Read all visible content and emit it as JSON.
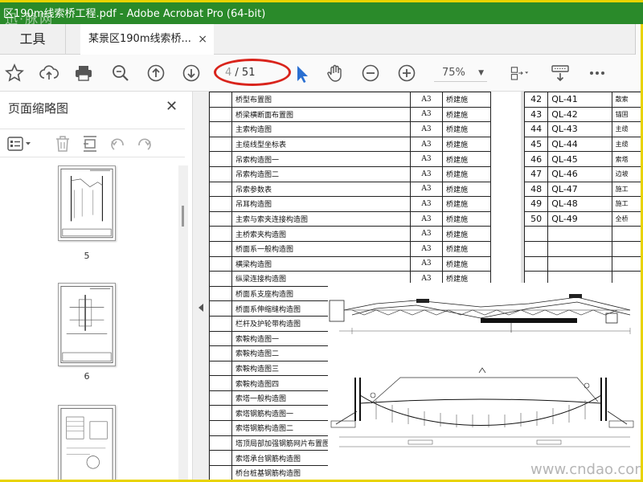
{
  "window": {
    "title": "区190m线索桥工程.pdf - Adobe Acrobat Pro (64-bit)",
    "watermark": "迅·脉网"
  },
  "tabs": {
    "tools_label": "工具",
    "doc_label": "某景区190m线索桥...",
    "close_glyph": "×"
  },
  "toolbar": {
    "page_current": "4",
    "page_total": "/ 51",
    "zoom": "75%"
  },
  "sidebar": {
    "title": "页面缩略图",
    "close_glyph": "✕",
    "thumbnails": [
      {
        "label": "5"
      },
      {
        "label": "6"
      }
    ]
  },
  "index_left": [
    {
      "name": "桥型布置图",
      "size": "A3",
      "by": "桥建施"
    },
    {
      "name": "桥梁横断面布置图",
      "size": "A3",
      "by": "桥建施"
    },
    {
      "name": "主索构造图",
      "size": "A3",
      "by": "桥建施"
    },
    {
      "name": "主缆线型坐标表",
      "size": "A3",
      "by": "桥建施"
    },
    {
      "name": "吊索构造图一",
      "size": "A3",
      "by": "桥建施"
    },
    {
      "name": "吊索构造图二",
      "size": "A3",
      "by": "桥建施"
    },
    {
      "name": "吊索参数表",
      "size": "A3",
      "by": "桥建施"
    },
    {
      "name": "吊耳构造图",
      "size": "A3",
      "by": "桥建施"
    },
    {
      "name": "主索与索夹连接构造图",
      "size": "A3",
      "by": "桥建施"
    },
    {
      "name": "主桥索夹构造图",
      "size": "A3",
      "by": "桥建施"
    },
    {
      "name": "桥面系一般构造图",
      "size": "A3",
      "by": "桥建施"
    },
    {
      "name": "横梁构造图",
      "size": "A3",
      "by": "桥建施"
    },
    {
      "name": "纵梁连接构造图",
      "size": "A3",
      "by": "桥建施"
    },
    {
      "name": "桥面系支座构造图",
      "size": "",
      "by": ""
    },
    {
      "name": "桥面系伸缩缝构造图",
      "size": "",
      "by": ""
    },
    {
      "name": "栏杆及护轮带构造图",
      "size": "",
      "by": ""
    },
    {
      "name": "索鞍构造图一",
      "size": "",
      "by": ""
    },
    {
      "name": "索鞍构造图二",
      "size": "",
      "by": ""
    },
    {
      "name": "索鞍构造图三",
      "size": "",
      "by": ""
    },
    {
      "name": "索鞍构造图四",
      "size": "",
      "by": ""
    },
    {
      "name": "索塔一般构造图",
      "size": "",
      "by": ""
    },
    {
      "name": "索塔钢筋构造图一",
      "size": "",
      "by": ""
    },
    {
      "name": "索塔钢筋构造图二",
      "size": "",
      "by": ""
    },
    {
      "name": "塔顶局部加强钢筋网片布置图",
      "size": "A3",
      "by": "桥建施"
    },
    {
      "name": "索塔承台钢筋构造图",
      "size": "A3",
      "by": "桥建施"
    },
    {
      "name": "桥台桩基钢筋构造图",
      "size": "A3",
      "by": "桥建施"
    }
  ],
  "index_right": [
    {
      "n": "42",
      "code": "QL-41",
      "x": "散索"
    },
    {
      "n": "43",
      "code": "QL-42",
      "x": "锚固"
    },
    {
      "n": "44",
      "code": "QL-43",
      "x": "主缆"
    },
    {
      "n": "45",
      "code": "QL-44",
      "x": "主缆"
    },
    {
      "n": "46",
      "code": "QL-45",
      "x": "索塔"
    },
    {
      "n": "47",
      "code": "QL-46",
      "x": "边坡"
    },
    {
      "n": "48",
      "code": "QL-47",
      "x": "施工"
    },
    {
      "n": "49",
      "code": "QL-48",
      "x": "施工"
    },
    {
      "n": "50",
      "code": "QL-49",
      "x": "全桥"
    }
  ],
  "site_watermark": "www.cndao.com"
}
